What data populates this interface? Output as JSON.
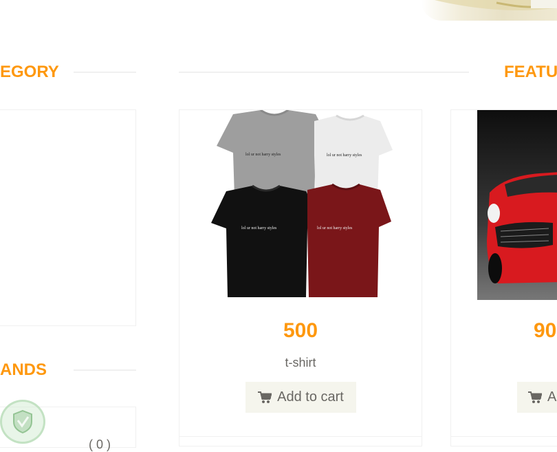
{
  "sections": {
    "category_title": "EGORY",
    "featured_title": "FEATU",
    "brands_title": "ANDS"
  },
  "products": [
    {
      "price": "500",
      "name": "t-shirt",
      "add_to_cart": "Add to cart",
      "shirt_print": "lol ur not harry styles"
    },
    {
      "price": "90",
      "name": "",
      "add_to_cart": "Ad"
    }
  ],
  "brands": {
    "count": "( 0 )"
  },
  "colors": {
    "accent": "#FE980F",
    "button_bg": "#F5F5ED",
    "text": "#696763",
    "border": "#F0F0F0"
  }
}
